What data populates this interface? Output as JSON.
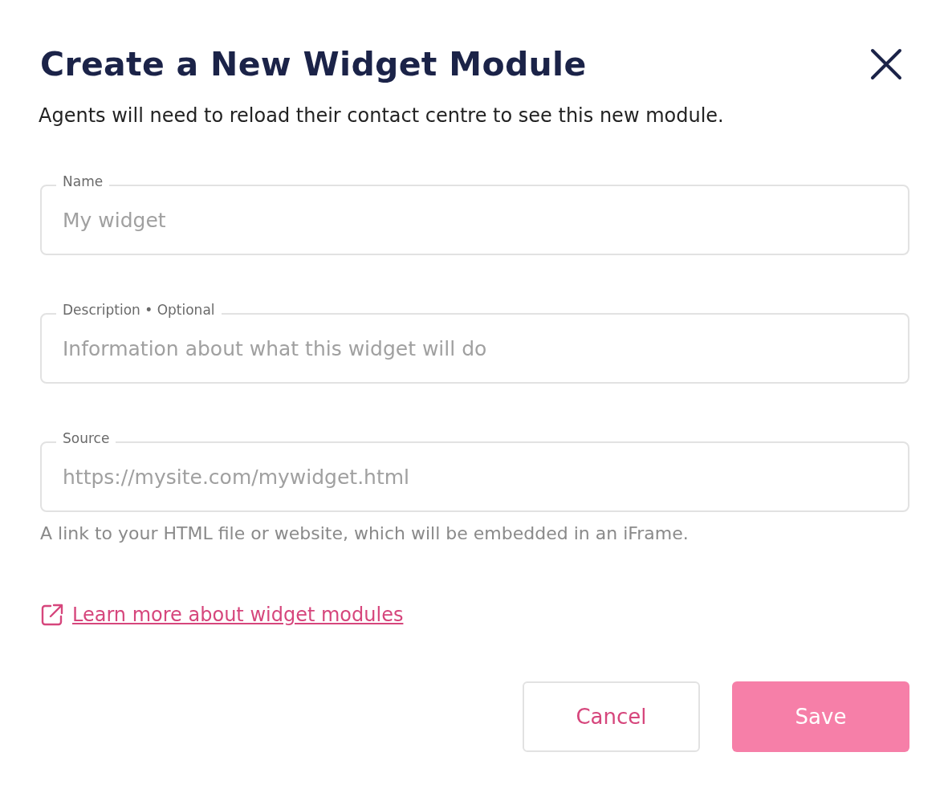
{
  "dialog": {
    "title": "Create a New Widget Module",
    "subtitle": "Agents will need to reload their contact centre to see this new module."
  },
  "fields": [
    {
      "label": "Name",
      "placeholder": "My widget"
    },
    {
      "label": "Description • Optional",
      "placeholder": "Information about what this widget will do"
    },
    {
      "label": "Source",
      "placeholder": "https://mysite.com/mywidget.html",
      "helper": "A link to your HTML file or website, which will be embedded in an iFrame."
    }
  ],
  "link": {
    "text": "Learn more about widget modules"
  },
  "buttons": [
    {
      "label": "Cancel",
      "kind": "secondary",
      "disabled": false
    },
    {
      "label": "Save",
      "kind": "primary",
      "disabled": true
    }
  ]
}
